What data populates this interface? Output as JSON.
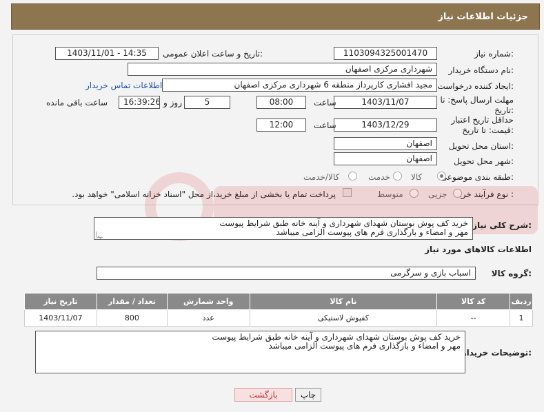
{
  "header": {
    "title": "جزئیات اطلاعات نیاز"
  },
  "form": {
    "need_number": {
      "label": "شماره نیاز:",
      "value": "1103094325001470"
    },
    "announce_datetime": {
      "label": "تاریخ و ساعت اعلان عمومی:",
      "value": "1403/11/01 - 14:35"
    },
    "buyer_org": {
      "label": "نام دستگاه خریدار:",
      "value": "شهرداری مرکزی اصفهان"
    },
    "requester": {
      "label": "ایجاد کننده درخواست:",
      "value": "مجید افشاری کارپرداز منطقه 6 شهرداری مرکزی اصفهان",
      "contact_link": "اطلاعات تماس خریدار"
    },
    "reply_deadline": {
      "label": "مهلت ارسال پاسخ: تا تاریخ:",
      "date": "1403/11/07",
      "time_label": "ساعت",
      "time": "08:00",
      "days": "5",
      "days_label": "روز و",
      "remaining": "16:39:26",
      "remaining_label": "ساعت باقی مانده"
    },
    "price_validity": {
      "label": "حداقل تاریخ اعتبار قیمت: تا تاریخ:",
      "date": "1403/12/29",
      "time_label": "ساعت",
      "time": "12:00"
    },
    "delivery_province": {
      "label": "استان محل تحویل:",
      "value": "اصفهان"
    },
    "delivery_city": {
      "label": "شهر محل تحویل:",
      "value": "اصفهان"
    },
    "category": {
      "label": "طبقه بندی موضوعی:",
      "options": [
        "کالا",
        "خدمت",
        "کالا/خدمت"
      ],
      "selected": "کالا"
    },
    "purchase_type": {
      "label": "نوع فرآیند خرید :",
      "options": [
        "جزیی",
        "متوسط"
      ],
      "selected": "",
      "payment_note": "پرداخت تمام یا بخشی از مبلغ خرید،از محل \"اسناد خزانه اسلامی\" خواهد بود."
    }
  },
  "summary": {
    "label": "شرح کلی نیاز:",
    "line1": "خرید کف پوش بوستان شهدای شهرداری و آینه خانه طبق شرایط پیوست",
    "line2": "مهر و امضاء و بارگذاری فرم های پیوست الزامی میباشد"
  },
  "goods": {
    "section_title": "اطلاعات کالاهای مورد نیاز",
    "group_label": "گروه کالا:",
    "group_value": "اسباب بازی و سرگرمی",
    "columns": [
      "ردیف",
      "کد کالا",
      "نام کالا",
      "واحد شمارش",
      "تعداد / مقدار",
      "تاریخ نیاز"
    ],
    "rows": [
      {
        "row": "1",
        "code": "--",
        "name": "کفپوش لاستیکی",
        "unit": "عدد",
        "qty": "800",
        "date": "1403/11/07"
      }
    ]
  },
  "buyer_notes": {
    "label": "توضیحات خریدار:",
    "line1": "خرید کف پوش بوستان شهدای شهرداری و آینه خانه طبق شرایط پیوست",
    "line2": "مهر و امضاء و بارگذاری فرم های پیوست الزامی میباشد"
  },
  "buttons": {
    "print": "چاپ",
    "back": "بازگشت"
  },
  "colors": {
    "header_bg": "#8d7550",
    "table_header_bg": "#8a8a8a",
    "back_button_text": "#b33333"
  }
}
